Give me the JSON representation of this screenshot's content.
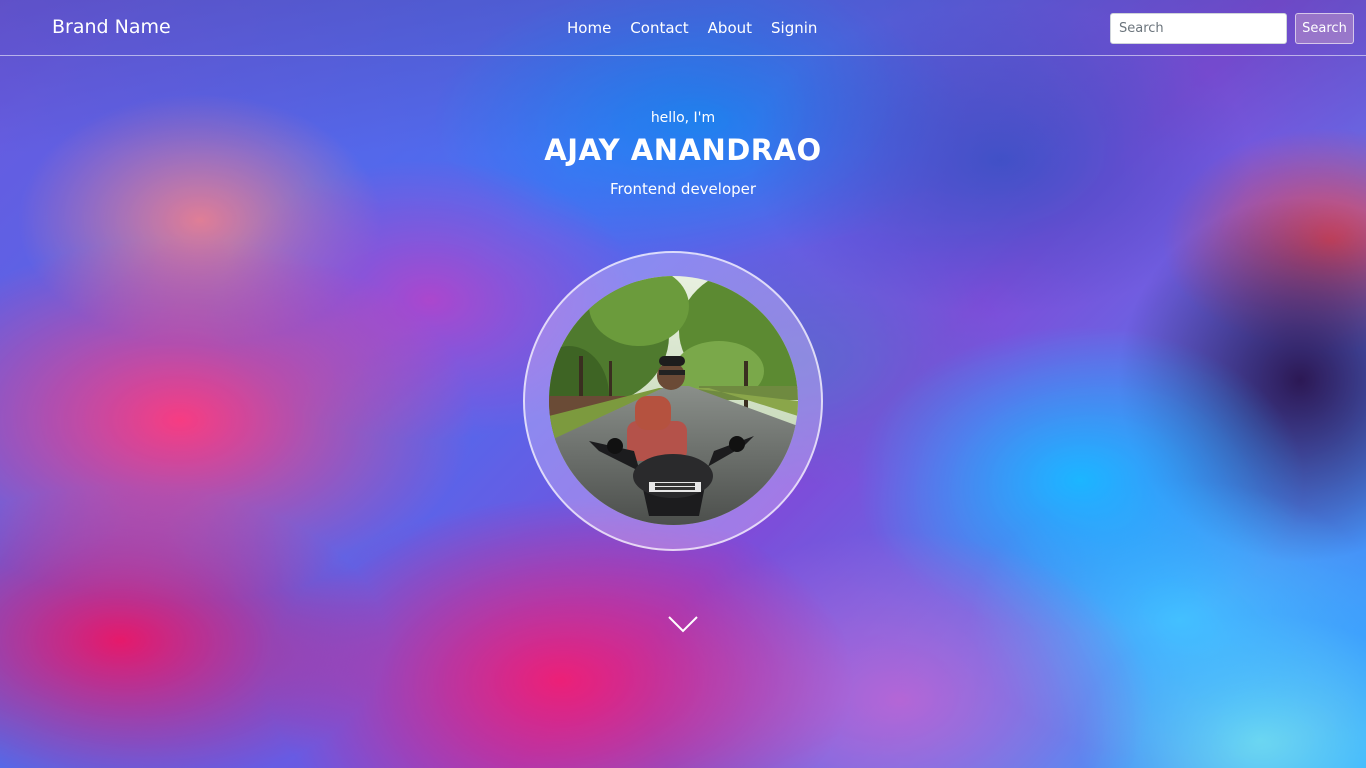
{
  "navbar": {
    "brand": "Brand Name",
    "links": [
      "Home",
      "Contact",
      "About",
      "Signin"
    ],
    "search": {
      "placeholder": "Search",
      "value": "",
      "button_label": "Search"
    }
  },
  "hero": {
    "greeting": "hello, I'm",
    "name": "AJAY ANANDRAO",
    "role": "Frontend developer",
    "photo_plate": "MH 28BN 4917"
  },
  "icons": {
    "scroll": "chevron-down-icon"
  },
  "colors": {
    "text": "#ffffff",
    "navbar_border": "#ffffff",
    "search_button_bg": "#be96c8"
  }
}
